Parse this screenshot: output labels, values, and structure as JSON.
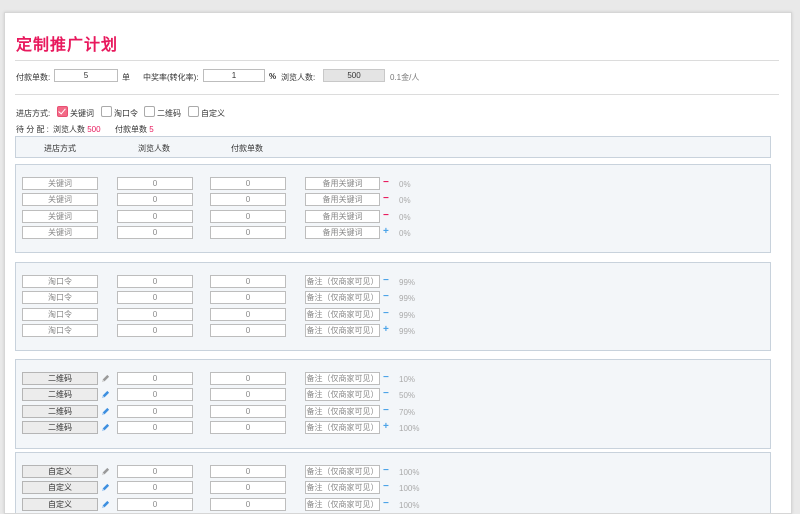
{
  "title": "定制推广计划",
  "top_form": {
    "order_label": "付款单数:",
    "order_value": "5",
    "order_unit": "单",
    "rate_label": "中奖率(转化率):",
    "rate_value": "1",
    "rate_unit": "%",
    "views_label": "浏览人数:",
    "views_value": "500",
    "price_note": "0.1金/人"
  },
  "methods": {
    "label": "进店方式:",
    "options": [
      {
        "label": "关键词",
        "checked": true
      },
      {
        "label": "淘口令",
        "checked": false
      },
      {
        "label": "二维码",
        "checked": false
      },
      {
        "label": "自定义",
        "checked": false
      }
    ]
  },
  "pending": {
    "label": "待 分 配 :",
    "views_label": "浏览人数",
    "views_value": "500",
    "orders_label": "付款单数",
    "orders_value": "5"
  },
  "table_header": {
    "col_method": "进店方式",
    "col_views": "浏览人数",
    "col_orders": "付款单数"
  },
  "colors": {
    "accent": "#e8195d",
    "blue": "#4aa3e8"
  },
  "groups": [
    {
      "type": "keyword",
      "rows": [
        {
          "method": "关键词",
          "views": "0",
          "orders": "0",
          "note": "备用关键词",
          "action": "minus",
          "pct": "0%"
        },
        {
          "method": "关键词",
          "views": "0",
          "orders": "0",
          "note": "备用关键词",
          "action": "minus",
          "pct": "0%"
        },
        {
          "method": "关键词",
          "views": "0",
          "orders": "0",
          "note": "备用关键词",
          "action": "minus",
          "pct": "0%"
        },
        {
          "method": "关键词",
          "views": "0",
          "orders": "0",
          "note": "备用关键词",
          "action": "plus",
          "pct": "0%"
        }
      ]
    },
    {
      "type": "taokouling",
      "rows": [
        {
          "method": "淘口令",
          "views": "0",
          "orders": "0",
          "note": "备注（仅商家可见）",
          "action": "minus",
          "pct": "99%"
        },
        {
          "method": "淘口令",
          "views": "0",
          "orders": "0",
          "note": "备注（仅商家可见）",
          "action": "minus",
          "pct": "99%"
        },
        {
          "method": "淘口令",
          "views": "0",
          "orders": "0",
          "note": "备注（仅商家可见）",
          "action": "minus",
          "pct": "99%"
        },
        {
          "method": "淘口令",
          "views": "0",
          "orders": "0",
          "note": "备注（仅商家可见）",
          "action": "plus",
          "pct": "99%"
        }
      ]
    },
    {
      "type": "qrcode",
      "rows": [
        {
          "method": "二维码",
          "views": "0",
          "orders": "0",
          "note": "备注（仅商家可见）",
          "action": "minus",
          "pct": "10%",
          "pencil": "gray"
        },
        {
          "method": "二维码",
          "views": "0",
          "orders": "0",
          "note": "备注（仅商家可见）",
          "action": "minus",
          "pct": "50%",
          "pencil": "blue"
        },
        {
          "method": "二维码",
          "views": "0",
          "orders": "0",
          "note": "备注（仅商家可见）",
          "action": "minus",
          "pct": "70%",
          "pencil": "blue"
        },
        {
          "method": "二维码",
          "views": "0",
          "orders": "0",
          "note": "备注（仅商家可见）",
          "action": "plus",
          "pct": "100%",
          "pencil": "blue"
        }
      ]
    },
    {
      "type": "custom",
      "rows": [
        {
          "method": "自定义",
          "views": "0",
          "orders": "0",
          "note": "备注（仅商家可见）",
          "action": "minus",
          "pct": "100%",
          "pencil": "gray"
        },
        {
          "method": "自定义",
          "views": "0",
          "orders": "0",
          "note": "备注（仅商家可见）",
          "action": "minus",
          "pct": "100%",
          "pencil": "blue"
        },
        {
          "method": "自定义",
          "views": "0",
          "orders": "0",
          "note": "备注（仅商家可见）",
          "action": "minus",
          "pct": "100%",
          "pencil": "blue"
        }
      ]
    }
  ]
}
